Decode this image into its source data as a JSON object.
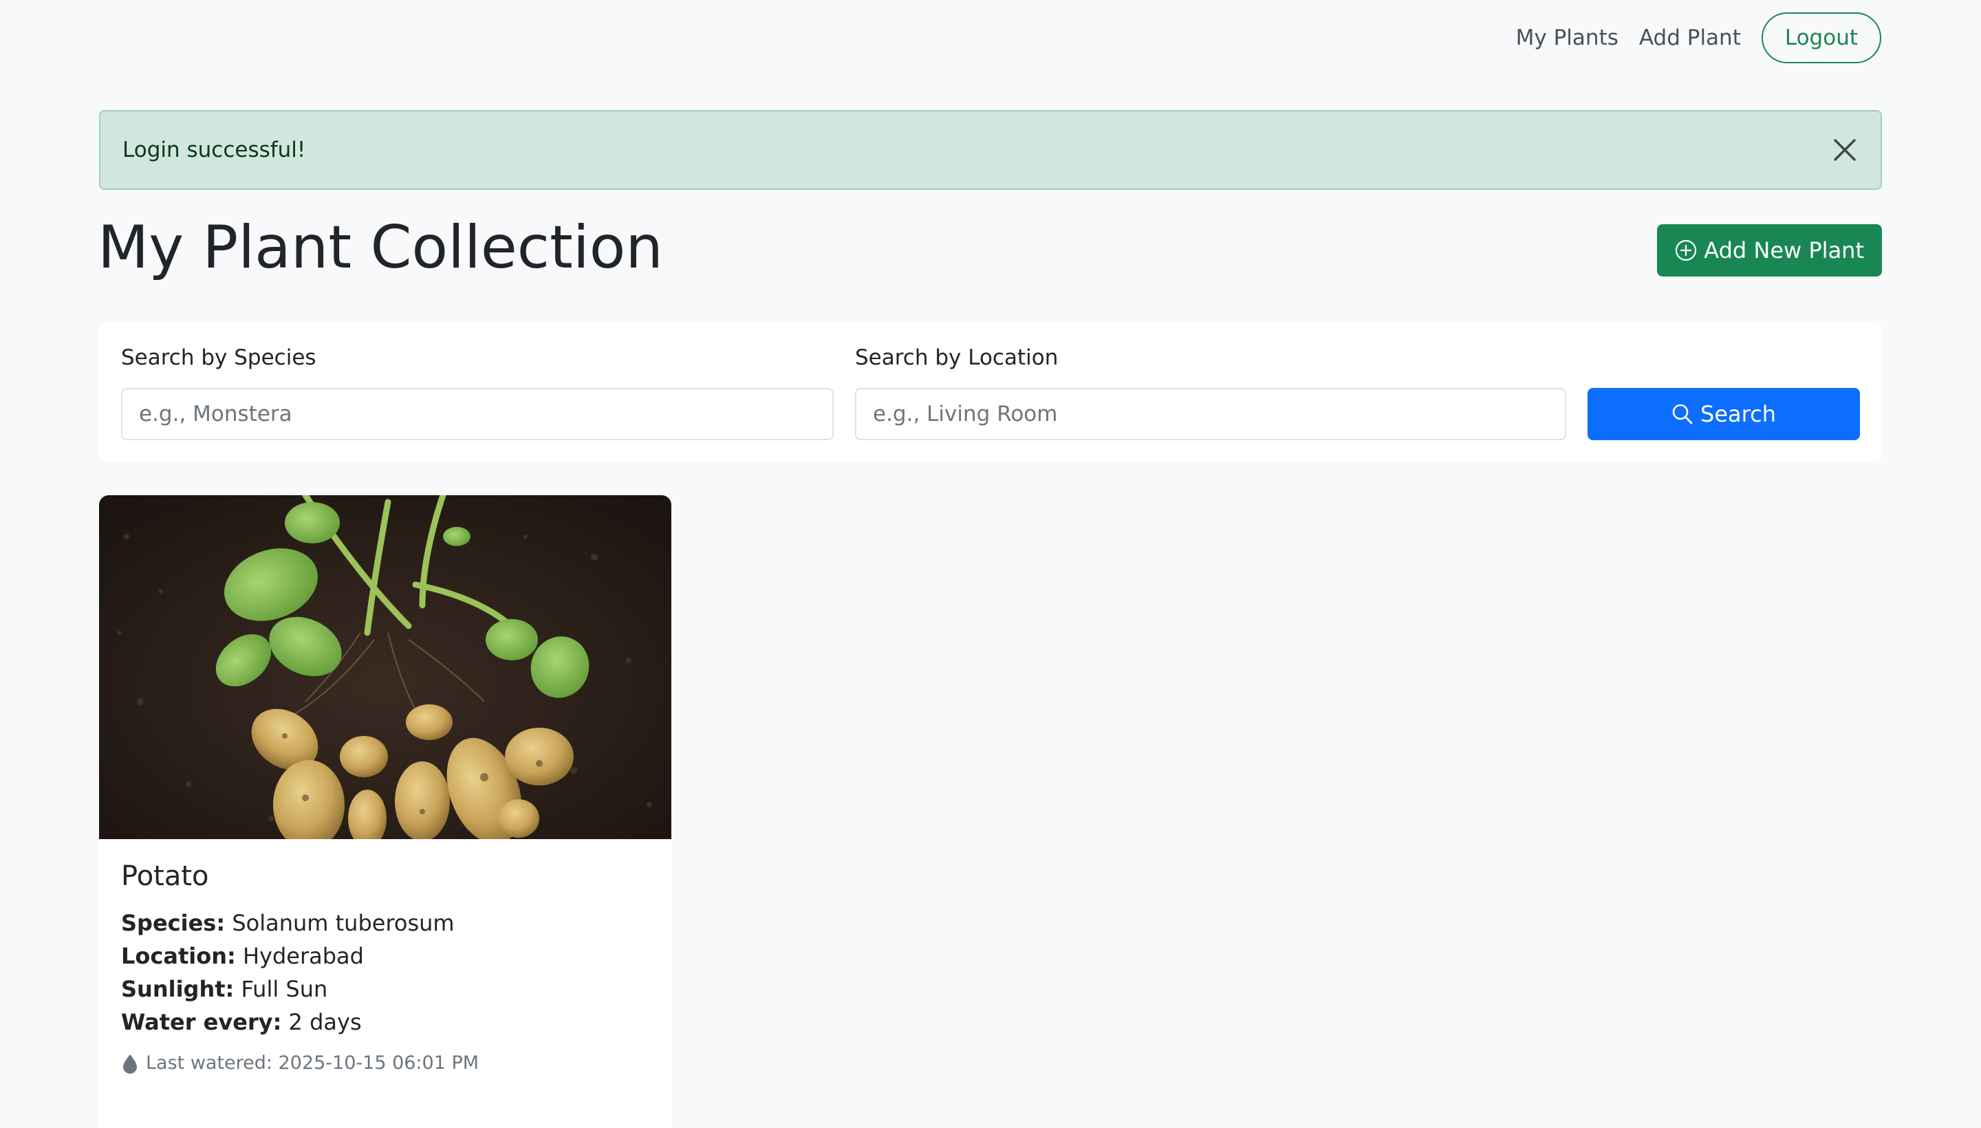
{
  "nav": {
    "my_plants": "My Plants",
    "add_plant": "Add Plant",
    "logout": "Logout"
  },
  "alert": {
    "message": "Login successful!"
  },
  "header": {
    "title": "My Plant Collection",
    "add_button": "Add New Plant"
  },
  "search": {
    "species_label": "Search by Species",
    "species_placeholder": "e.g., Monstera",
    "location_label": "Search by Location",
    "location_placeholder": "e.g., Living Room",
    "button": "Search"
  },
  "plants": [
    {
      "name": "Potato",
      "species_label": "Species:",
      "species": "Solanum tuberosum",
      "location_label": "Location:",
      "location": "Hyderabad",
      "sunlight_label": "Sunlight:",
      "sunlight": "Full Sun",
      "water_label": "Water every:",
      "water": "2 days",
      "last_watered": "Last watered: 2025-10-15 06:01 PM"
    }
  ],
  "colors": {
    "success": "#198754",
    "primary": "#0d6efd",
    "alert_bg": "#d1e7dd",
    "page_bg": "#f8f9fa"
  },
  "icons": {
    "close": "close-icon",
    "add": "plus-circle-icon",
    "search": "search-icon",
    "droplet": "droplet-icon"
  }
}
